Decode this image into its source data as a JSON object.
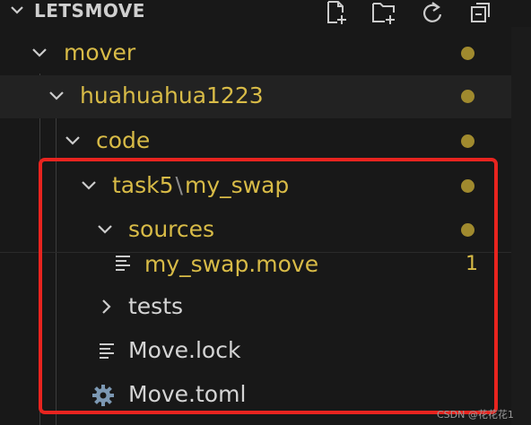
{
  "explorer": {
    "workspace_title": "LETSMOVE",
    "toolbar": {
      "new_file_icon": "new-file-icon",
      "new_folder_icon": "new-folder-icon",
      "refresh_icon": "refresh-icon",
      "collapse_icon": "collapse-all-icon"
    },
    "tree": [
      {
        "label": "mover",
        "type": "folder",
        "expanded": true,
        "modified": true
      },
      {
        "label": "huahuahua1223",
        "type": "folder",
        "expanded": true,
        "modified": true
      },
      {
        "label": "code",
        "type": "folder",
        "expanded": true,
        "modified": true
      },
      {
        "label_a": "task5",
        "label_sep": "\\",
        "label_b": "my_swap",
        "type": "folder",
        "expanded": true,
        "modified": true
      },
      {
        "label": "sources",
        "type": "folder",
        "expanded": true,
        "modified": true
      },
      {
        "label": "my_swap.move",
        "type": "file",
        "problems": "1"
      },
      {
        "label": "tests",
        "type": "folder",
        "expanded": false
      },
      {
        "label": "Move.lock",
        "type": "file"
      },
      {
        "label": "Move.toml",
        "type": "file"
      }
    ]
  },
  "colors": {
    "modified": "#d8bb47",
    "highlight_border": "#e8241f",
    "background": "#181818"
  },
  "watermark": "CSDN @花花花1"
}
